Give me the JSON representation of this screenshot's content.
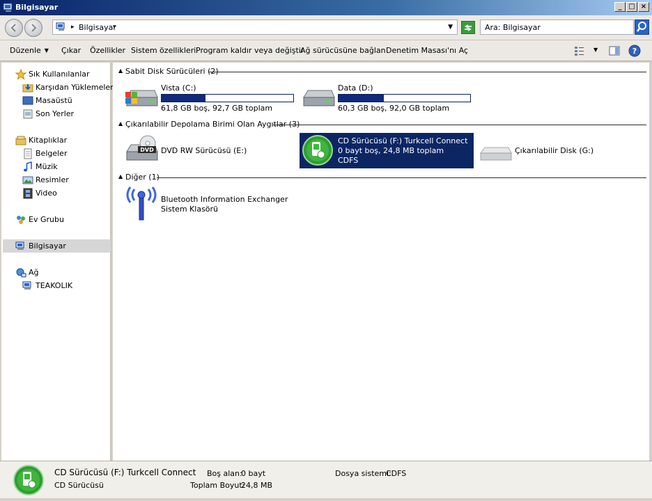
{
  "window": {
    "title": "Bilgisayar"
  },
  "address": {
    "crumb": "Bilgisayar",
    "search_placeholder": "Ara: Bilgisayar"
  },
  "toolbar": {
    "organize": "Düzenle",
    "eject": "Çıkar",
    "properties": "Özellikler",
    "system_properties": "Sistem özellikleri",
    "uninstall": "Program kaldır veya değiştir",
    "map_drive": "Ağ sürücüsüne bağlan",
    "control_panel": "Denetim Masası'nı Aç"
  },
  "sidebar": {
    "favorites": "Sık Kullanılanlar",
    "downloads": "Karşıdan Yüklemeler",
    "desktop": "Masaüstü",
    "recent": "Son Yerler",
    "libraries": "Kitaplıklar",
    "documents": "Belgeler",
    "music": "Müzik",
    "pictures": "Resimler",
    "video": "Video",
    "homegroup": "Ev Grubu",
    "computer": "Bilgisayar",
    "network": "Ağ",
    "network_pc": "TEAKOLIK"
  },
  "groups": {
    "hdd": "Sabit Disk Sürücüleri (2)",
    "removable": "Çıkarılabilir Depolama Birimi Olan Aygıtlar (3)",
    "other": "Diğer (1)"
  },
  "drives": {
    "c": {
      "name": "Vista (C:)",
      "info": "61,8 GB boş, 92,7 GB toplam",
      "used_fraction": 0.333
    },
    "d": {
      "name": "Data (D:)",
      "info": "60,3 GB boş, 92,0 GB toplam",
      "used_fraction": 0.345
    },
    "e": {
      "name": "DVD RW Sürücüsü (E:)",
      "badge": "DVD"
    },
    "f": {
      "name": "CD Sürücüsü (F:) Turkcell Connect",
      "info": "0 bayt boş, 24,8 MB toplam",
      "fs": "CDFS"
    },
    "g": {
      "name": "Çıkarılabilir Disk (G:)"
    },
    "bt": {
      "name": "Bluetooth Information Exchanger",
      "type": "Sistem Klasörü"
    }
  },
  "status": {
    "name": "CD Sürücüsü (F:) Turkcell Connect",
    "type": "CD Sürücüsü",
    "free_label": "Boş alan:",
    "free_value": "0 bayt",
    "total_label": "Toplam Boyut:",
    "total_value": "24,8 MB",
    "fs_label": "Dosya sistemi:",
    "fs_value": "CDFS"
  }
}
